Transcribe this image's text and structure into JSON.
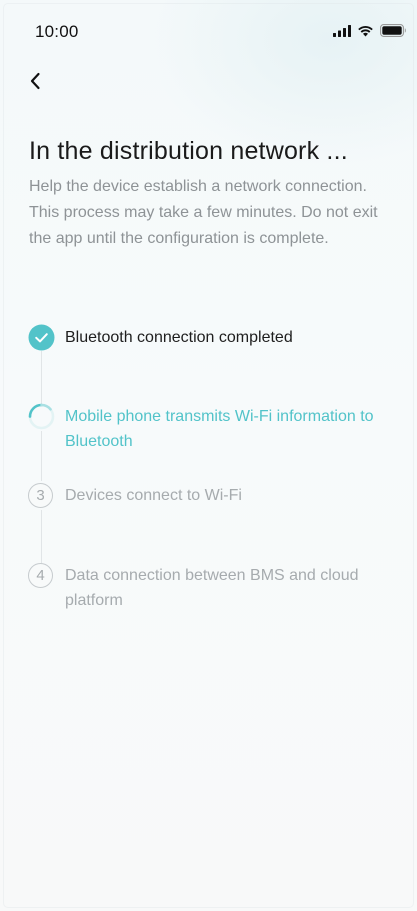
{
  "status_bar": {
    "time": "10:00",
    "icons": [
      "signal-icon",
      "wifi-icon",
      "battery-icon"
    ]
  },
  "header": {
    "back_icon": "chevron-left-icon"
  },
  "main": {
    "title": "In the distribution network ...",
    "description": "Help the device establish a network connection. This process may take a few minutes. Do not exit the app until the configuration is complete."
  },
  "steps": [
    {
      "state": "completed",
      "label": "Bluetooth connection completed",
      "icon": "check-icon"
    },
    {
      "state": "in-progress",
      "label": "Mobile phone transmits Wi-Fi information to Bluetooth",
      "icon": "loading-spinner-icon"
    },
    {
      "state": "pending",
      "number": "3",
      "label": "Devices connect to Wi-Fi"
    },
    {
      "state": "pending",
      "number": "4",
      "label": "Data connection between BMS and cloud platform"
    }
  ],
  "colors": {
    "accent": "#52c3c9",
    "text_primary": "#1e1e1e",
    "text_secondary": "#8e9396",
    "text_disabled": "#a6abae",
    "line": "#e1e5e7"
  }
}
